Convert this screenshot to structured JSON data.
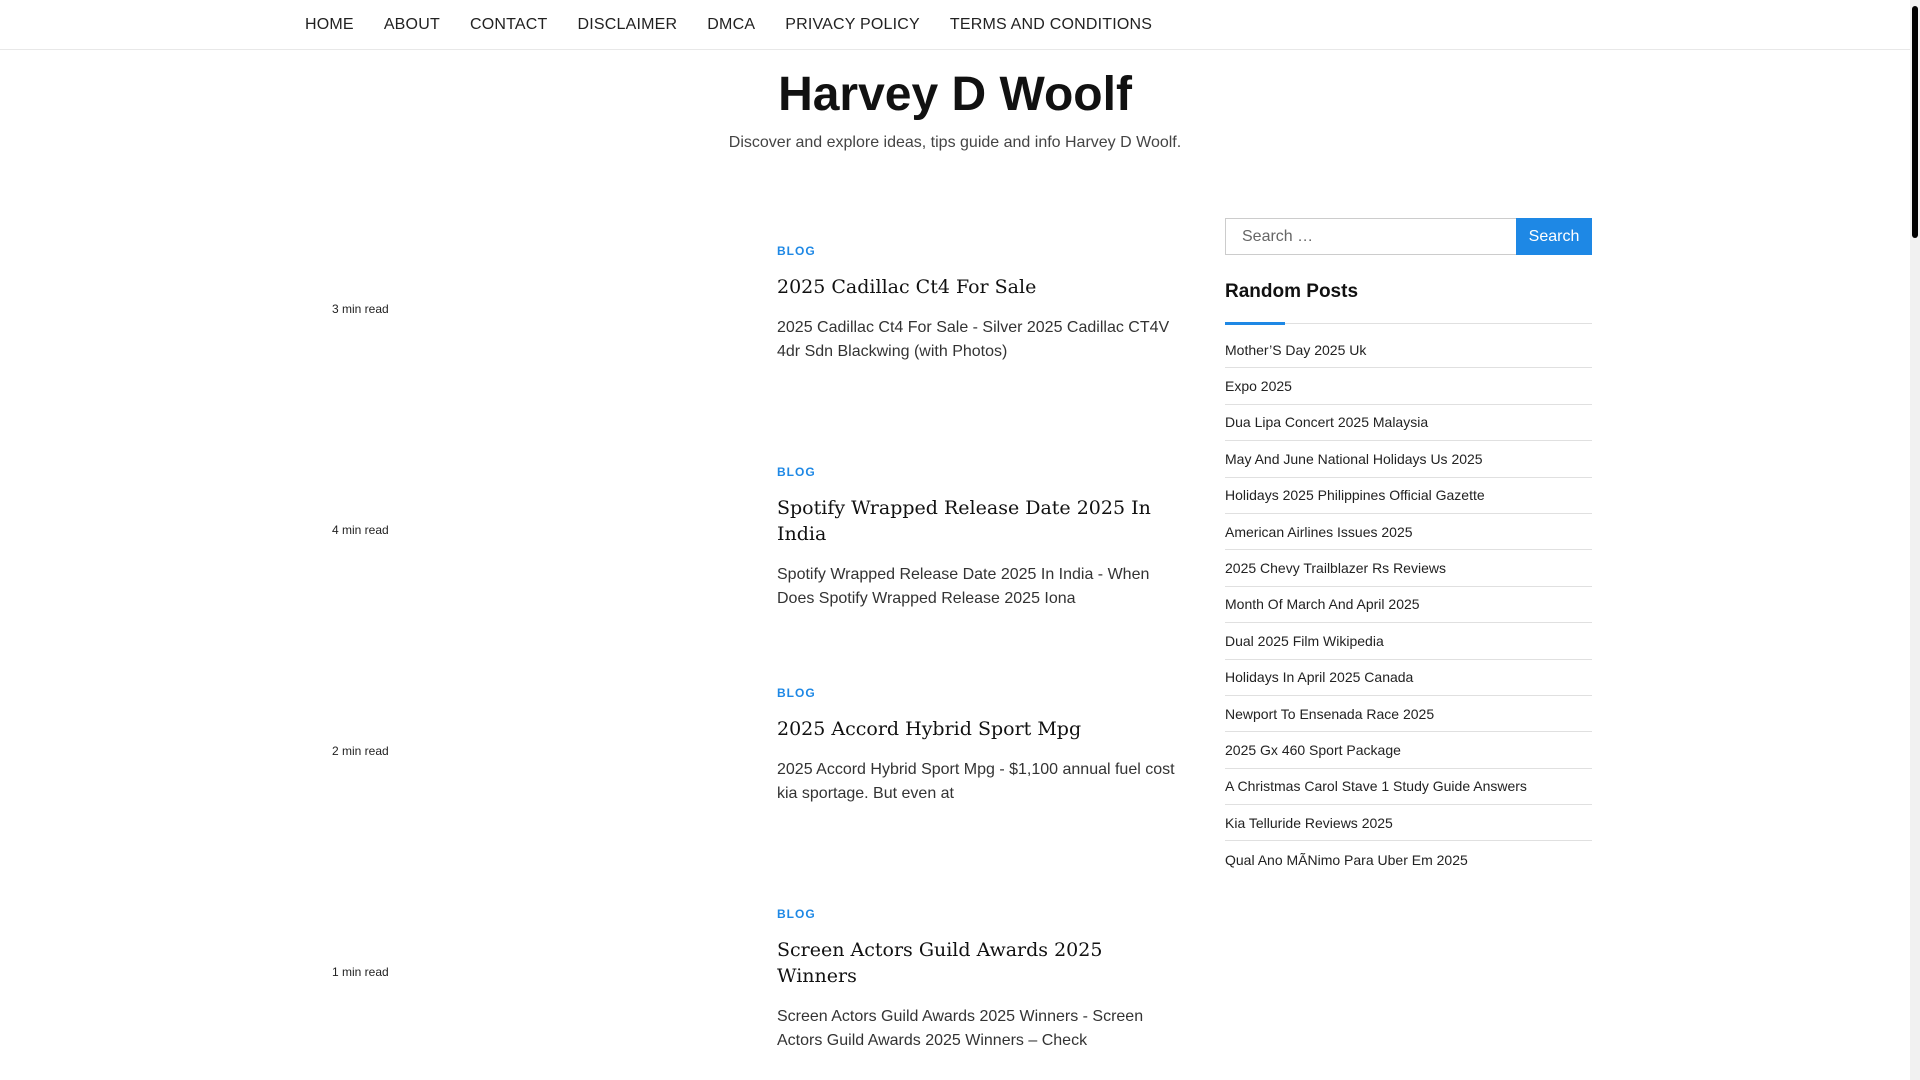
{
  "nav": {
    "items": [
      {
        "label": "HOME"
      },
      {
        "label": "ABOUT"
      },
      {
        "label": "CONTACT"
      },
      {
        "label": "DISCLAIMER"
      },
      {
        "label": "DMCA"
      },
      {
        "label": "PRIVACY POLICY"
      },
      {
        "label": "TERMS AND CONDITIONS"
      }
    ]
  },
  "site": {
    "title": "Harvey D Woolf",
    "description": "Discover and explore ideas, tips guide and info Harvey D Woolf."
  },
  "posts": [
    {
      "read_time": "3 min read",
      "category": "BLOG",
      "title": "2025 Cadillac Ct4 For Sale",
      "excerpt": "2025 Cadillac Ct4 For Sale - Silver 2025 Cadillac CT4V 4dr Sdn Blackwing (with Photos)"
    },
    {
      "read_time": "4 min read",
      "category": "BLOG",
      "title": "Spotify Wrapped Release Date 2025 In India",
      "excerpt": "Spotify Wrapped Release Date 2025 In India - When Does Spotify Wrapped Release 2025 Iona"
    },
    {
      "read_time": "2 min read",
      "category": "BLOG",
      "title": "2025 Accord Hybrid Sport Mpg",
      "excerpt": "2025 Accord Hybrid Sport Mpg - $1,100 annual fuel cost kia sportage. But even at"
    },
    {
      "read_time": "1 min read",
      "category": "BLOG",
      "title": "Screen Actors Guild Awards 2025 Winners",
      "excerpt": "Screen Actors Guild Awards 2025 Winners - Screen Actors Guild Awards 2025 Winners – Check"
    }
  ],
  "sidebar": {
    "search": {
      "placeholder": "Search …",
      "button_label": "Search"
    },
    "random_title": "Random Posts",
    "random_posts": [
      "Mother’S Day 2025 Uk",
      "Expo 2025",
      "Dua Lipa Concert 2025 Malaysia",
      "May And June National Holidays Us 2025",
      "Holidays 2025 Philippines Official Gazette",
      "American Airlines Issues 2025",
      "2025 Chevy Trailblazer Rs Reviews",
      "Month Of March And April 2025",
      "Dual 2025 Film Wikipedia",
      "Holidays In April 2025 Canada",
      "Newport To Ensenada Race 2025",
      "2025 Gx 460 Sport Package",
      "A Christmas Carol Stave 1 Study Guide Answers",
      "Kia Telluride Reviews 2025",
      "Qual Ano MÃNimo Para Uber Em 2025"
    ]
  },
  "colors": {
    "accent": "#1e88e5"
  }
}
